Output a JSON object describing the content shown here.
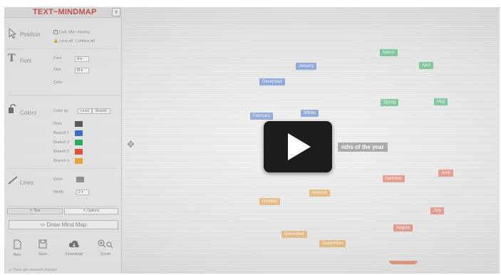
{
  "app": {
    "title": "TEXT~MINDMAP",
    "collapse_symbol": "∨"
  },
  "position": {
    "label": "Position",
    "lock_checkbox_label": "Lock after moving",
    "lock_all": "Lock all",
    "unlock_all": "Unlock all"
  },
  "font": {
    "label": "Font",
    "font_label": "Font",
    "font_value": "A",
    "size_label": "Size",
    "size_value": "M",
    "color_label": "Color"
  },
  "colors": {
    "label": "Colors",
    "color_by_label": "Color by",
    "level_button": "Level",
    "branch_button": "Branch",
    "swatches": [
      {
        "label": "Root",
        "color": "#595959"
      },
      {
        "label": "Branch 1",
        "color": "#3b6fc4"
      },
      {
        "label": "Branch 2",
        "color": "#2aaa5a"
      },
      {
        "label": "Branch 3",
        "color": "#e0533a"
      },
      {
        "label": "Branch 4",
        "color": "#e6a23c"
      }
    ]
  },
  "lines": {
    "label": "Lines",
    "color_label": "Color",
    "line_color": "#8f8f8f",
    "width_label": "Width",
    "width_value": "2"
  },
  "tabs": {
    "text": "Text",
    "options": "Options"
  },
  "draw_button": "Draw Mind Map",
  "toolbar": {
    "new": "New",
    "save": "Save",
    "download": "Download",
    "zoom": "Zoom"
  },
  "status": "There are unsaved changes",
  "mindmap": {
    "center": "nths of the year",
    "nodes": [
      {
        "text": "January",
        "color": "blue"
      },
      {
        "text": "December",
        "color": "blue"
      },
      {
        "text": "February",
        "color": "blue"
      },
      {
        "text": "Winter",
        "color": "blue"
      },
      {
        "text": "March",
        "color": "green"
      },
      {
        "text": "April",
        "color": "green"
      },
      {
        "text": "Spring",
        "color": "green"
      },
      {
        "text": "May",
        "color": "green"
      },
      {
        "text": "Summer",
        "color": "red"
      },
      {
        "text": "June",
        "color": "red"
      },
      {
        "text": "July",
        "color": "red"
      },
      {
        "text": "August",
        "color": "red"
      },
      {
        "text": "Autumn",
        "color": "orange"
      },
      {
        "text": "October",
        "color": "orange"
      },
      {
        "text": "November",
        "color": "orange"
      },
      {
        "text": "September",
        "color": "orange"
      }
    ]
  }
}
